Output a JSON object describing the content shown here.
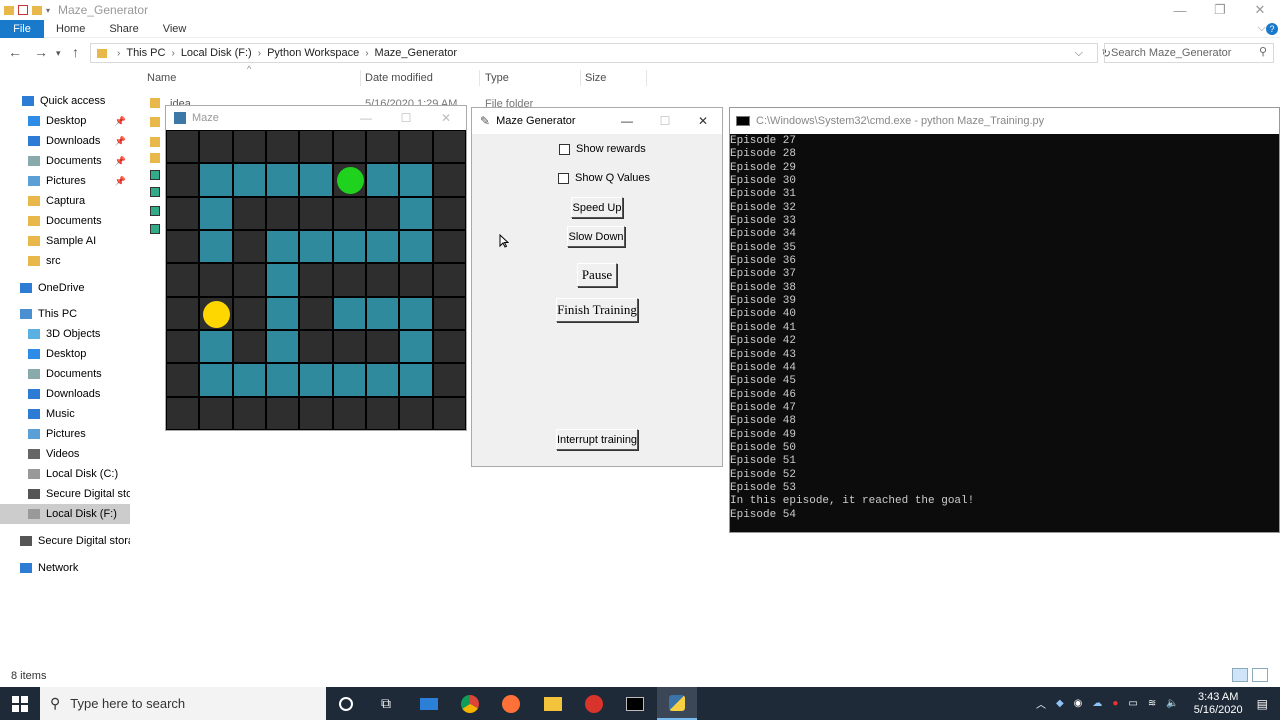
{
  "explorer": {
    "title": "Maze_Generator",
    "ribbon_tabs": [
      "File",
      "Home",
      "Share",
      "View"
    ],
    "breadcrumb": [
      "This PC",
      "Local Disk (F:)",
      "Python Workspace",
      "Maze_Generator"
    ],
    "search_placeholder": "Search Maze_Generator",
    "columns": [
      "Name",
      "Date modified",
      "Type",
      "Size"
    ],
    "first_row": {
      "name": ".idea",
      "date": "5/16/2020 1:29 AM",
      "type": "File folder"
    },
    "status": "8 items",
    "nav": [
      {
        "label": "Quick access",
        "icon": "star-icon"
      },
      {
        "label": "Desktop",
        "icon": "desktop-icon",
        "pinned": true
      },
      {
        "label": "Downloads",
        "icon": "download-icon",
        "pinned": true
      },
      {
        "label": "Documents",
        "icon": "document-icon",
        "pinned": true
      },
      {
        "label": "Pictures",
        "icon": "picture-icon",
        "pinned": true
      },
      {
        "label": "Captura",
        "icon": "folder-icon"
      },
      {
        "label": "Documents",
        "icon": "folder-icon"
      },
      {
        "label": "Sample AI",
        "icon": "folder-icon"
      },
      {
        "label": "src",
        "icon": "folder-icon"
      },
      {
        "label": "OneDrive",
        "icon": "cloud-icon"
      },
      {
        "label": "This PC",
        "icon": "computer-icon"
      },
      {
        "label": "3D Objects",
        "icon": "cube-icon"
      },
      {
        "label": "Desktop",
        "icon": "desktop-icon"
      },
      {
        "label": "Documents",
        "icon": "document-icon"
      },
      {
        "label": "Downloads",
        "icon": "download-icon"
      },
      {
        "label": "Music",
        "icon": "music-icon"
      },
      {
        "label": "Pictures",
        "icon": "picture-icon"
      },
      {
        "label": "Videos",
        "icon": "video-icon"
      },
      {
        "label": "Local Disk (C:)",
        "icon": "disk-icon"
      },
      {
        "label": "Secure Digital stora",
        "icon": "sd-card-icon"
      },
      {
        "label": "Local Disk (F:)",
        "icon": "disk-icon",
        "selected": true
      },
      {
        "label": "Secure Digital storag",
        "icon": "sd-card-icon"
      },
      {
        "label": "Network",
        "icon": "network-icon"
      }
    ]
  },
  "maze": {
    "title": "Maze",
    "grid": [
      "WWWWWWWWW",
      "WPPPPGPPW",
      "WPWWWWWPW",
      "WPWPPPPPW",
      "WWWPWWWWW",
      "WAWPWPPPW",
      "WPWPWWWPW",
      "WPPPPPPPW",
      "WWWWWWWWW"
    ],
    "colors": {
      "wall": "#2e2e2e",
      "path": "#2e8a9c",
      "goal": "#1ed21e",
      "agent": "#ffd700"
    }
  },
  "generator": {
    "title": "Maze Generator",
    "show_rewards": "Show rewards",
    "show_q_values": "Show Q Values",
    "speed_up": "Speed Up",
    "slow_down": "Slow Down",
    "pause": "Pause",
    "finish_training": "Finish Training",
    "interrupt_training": "Interrupt training"
  },
  "cmd": {
    "title": "C:\\Windows\\System32\\cmd.exe - python  Maze_Training.py",
    "lines": [
      "Episode 27",
      "Episode 28",
      "Episode 29",
      "Episode 30",
      "Episode 31",
      "Episode 32",
      "Episode 33",
      "Episode 34",
      "Episode 35",
      "Episode 36",
      "Episode 37",
      "Episode 38",
      "Episode 39",
      "Episode 40",
      "Episode 41",
      "Episode 42",
      "Episode 43",
      "Episode 44",
      "Episode 45",
      "Episode 46",
      "Episode 47",
      "Episode 48",
      "Episode 49",
      "Episode 50",
      "Episode 51",
      "Episode 52",
      "Episode 53",
      "In this episode, it reached the goal!",
      "Episode 54"
    ]
  },
  "taskbar": {
    "search_placeholder": "Type here to search",
    "time": "3:43 AM",
    "date": "5/16/2020"
  }
}
